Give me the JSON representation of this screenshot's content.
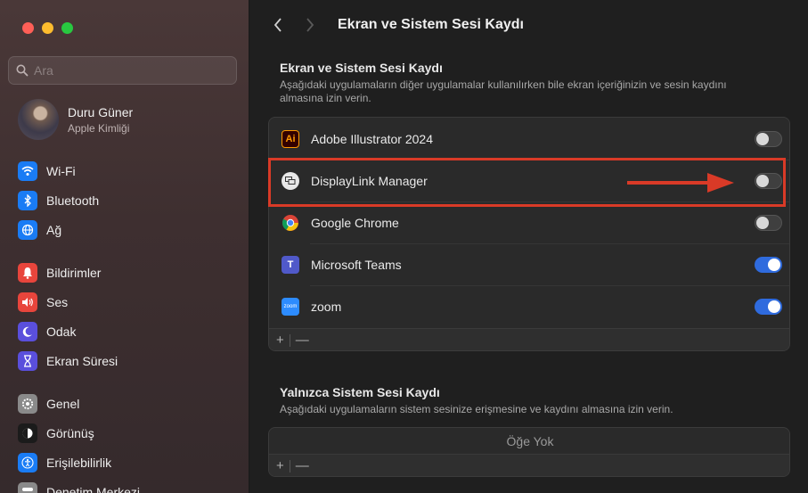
{
  "sidebar": {
    "search_placeholder": "Ara",
    "user": {
      "name": "Duru Güner",
      "subtitle": "Apple Kimliği"
    },
    "items": [
      {
        "label": "Wi-Fi",
        "icon": "wifi-icon",
        "color": "#1a7cf5"
      },
      {
        "label": "Bluetooth",
        "icon": "bluetooth-icon",
        "color": "#1a7cf5"
      },
      {
        "label": "Ağ",
        "icon": "globe-icon",
        "color": "#1a7cf5"
      },
      {
        "label": "Bildirimler",
        "icon": "bell-icon",
        "color": "#e8453c"
      },
      {
        "label": "Ses",
        "icon": "speaker-icon",
        "color": "#e8453c"
      },
      {
        "label": "Odak",
        "icon": "moon-icon",
        "color": "#5a4fdc"
      },
      {
        "label": "Ekran Süresi",
        "icon": "hourglass-icon",
        "color": "#5a4fdc"
      },
      {
        "label": "Genel",
        "icon": "gear-icon",
        "color": "#8a8a8a"
      },
      {
        "label": "Görünüş",
        "icon": "appearance-icon",
        "color": "#1b1b1b"
      },
      {
        "label": "Erişilebilirlik",
        "icon": "accessibility-icon",
        "color": "#1a7cf5"
      },
      {
        "label": "Denetim Merkezi",
        "icon": "control-center-icon",
        "color": "#8a8a8a"
      }
    ]
  },
  "header": {
    "title": "Ekran ve Sistem Sesi Kaydı"
  },
  "screen_section": {
    "title": "Ekran ve Sistem Sesi Kaydı",
    "description": "Aşağıdaki uygulamaların diğer uygulamalar kullanılırken bile ekran içeriğinizin ve sesin kaydını almasına izin verin.",
    "apps": [
      {
        "name": "Adobe Illustrator 2024",
        "enabled": false,
        "icon": "illustrator-icon"
      },
      {
        "name": "DisplayLink Manager",
        "enabled": false,
        "icon": "displaylink-icon"
      },
      {
        "name": "Google Chrome",
        "enabled": false,
        "icon": "chrome-icon"
      },
      {
        "name": "Microsoft Teams",
        "enabled": true,
        "icon": "teams-icon"
      },
      {
        "name": "zoom",
        "enabled": true,
        "icon": "zoom-icon"
      }
    ],
    "add_label": "+",
    "remove_label": "—"
  },
  "audio_section": {
    "title": "Yalnızca Sistem Sesi Kaydı",
    "description": "Aşağıdaki uygulamaların sistem sesinize erişmesine ve kaydını almasına izin verin.",
    "empty_label": "Öğe Yok",
    "add_label": "+",
    "remove_label": "—"
  },
  "colors": {
    "accent": "#2f6bde",
    "highlight": "#d93a27"
  }
}
